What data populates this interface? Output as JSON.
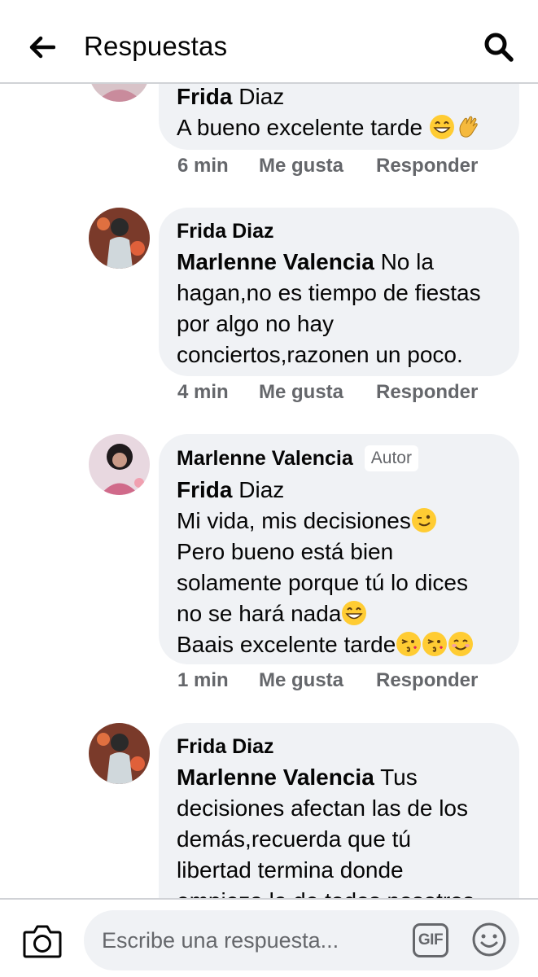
{
  "header": {
    "title": "Respuestas",
    "back_icon": "arrow-left-icon",
    "search_icon": "search-icon"
  },
  "comments": [
    {
      "mention_first": "Frida",
      "mention_rest": " Diaz",
      "text": "A bueno excelente tarde",
      "emojis": [
        "grinning-face",
        "waving-hand"
      ],
      "time": "6 min",
      "like_label": "Me gusta",
      "reply_label": "Responder"
    },
    {
      "author": "Frida Diaz",
      "mention": "Marlenne Valencia",
      "text_line1": " No la",
      "text_line2": "hagan,no es tiempo de fiestas",
      "text_line3": "por algo no hay",
      "text_line4": "conciertos,razonen un poco.",
      "time": "4 min",
      "like_label": "Me gusta",
      "reply_label": "Responder"
    },
    {
      "author": "Marlenne Valencia",
      "badge": "Autor",
      "mention_first": "Frida",
      "mention_rest": " Diaz",
      "line1": "Mi vida, mis decisiones",
      "line2": "Pero bueno está bien",
      "line3": "solamente porque tú lo dices",
      "line4": "no se hará nada",
      "line5": "Baais excelente tarde",
      "time": "1 min",
      "like_label": "Me gusta",
      "reply_label": "Responder"
    },
    {
      "author": "Frida Diaz",
      "mention": "Marlenne Valencia",
      "text_line1": " Tus",
      "text_line2": "decisiones afectan las de los",
      "text_line3": "demás,recuerda que tú",
      "text_line4": "libertad termina donde",
      "text_line5": "empieza la de todos nosotros"
    }
  ],
  "composer": {
    "placeholder": "Escribe una respuesta...",
    "gif_label": "GIF",
    "camera_icon": "camera-icon",
    "emoji_icon": "smiley-icon"
  },
  "colors": {
    "bubble": "#f0f2f5",
    "secondary_text": "#65676b",
    "primary_text": "#050505",
    "divider": "#d0d2d6"
  }
}
